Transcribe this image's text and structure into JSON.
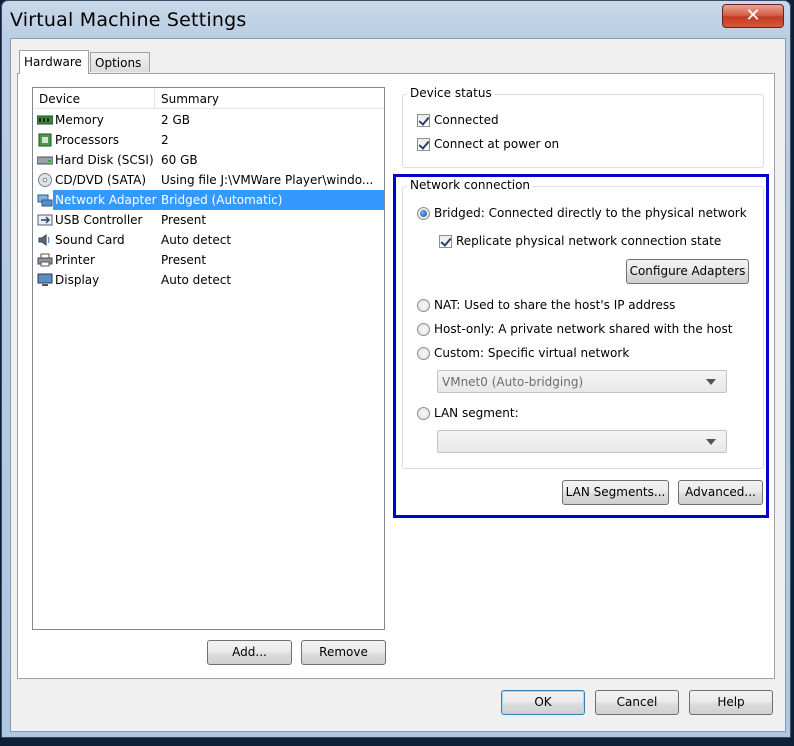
{
  "window": {
    "title": "Virtual Machine Settings",
    "close_label": "✕"
  },
  "tabs": [
    "Hardware",
    "Options"
  ],
  "device_list": {
    "headers": {
      "device": "Device",
      "summary": "Summary"
    },
    "rows": [
      {
        "name": "Memory",
        "summary": "2 GB",
        "icon": "memory-icon"
      },
      {
        "name": "Processors",
        "summary": "2",
        "icon": "processor-icon"
      },
      {
        "name": "Hard Disk (SCSI)",
        "summary": "60 GB",
        "icon": "hard-disk-icon"
      },
      {
        "name": "CD/DVD (SATA)",
        "summary": "Using file J:\\VMWare Player\\windo...",
        "icon": "cd-dvd-icon"
      },
      {
        "name": "Network Adapter",
        "summary": "Bridged (Automatic)",
        "icon": "network-adapter-icon",
        "selected": true
      },
      {
        "name": "USB Controller",
        "summary": "Present",
        "icon": "usb-icon"
      },
      {
        "name": "Sound Card",
        "summary": "Auto detect",
        "icon": "speaker-icon"
      },
      {
        "name": "Printer",
        "summary": "Present",
        "icon": "printer-icon"
      },
      {
        "name": "Display",
        "summary": "Auto detect",
        "icon": "display-icon"
      }
    ]
  },
  "list_buttons": {
    "add": "Add...",
    "remove": "Remove"
  },
  "device_status": {
    "title": "Device status",
    "connected": {
      "label": "Connected",
      "checked": true
    },
    "connect_at_power_on": {
      "label": "Connect at power on",
      "checked": true
    }
  },
  "network_connection": {
    "title": "Network connection",
    "bridged": {
      "label": "Bridged: Connected directly to the physical network",
      "checked": true
    },
    "replicate": {
      "label": "Replicate physical network connection state",
      "checked": true
    },
    "configure_adapters": "Configure Adapters",
    "nat": "NAT: Used to share the host's IP address",
    "host_only": "Host-only: A private network shared with the host",
    "custom": "Custom: Specific virtual network",
    "custom_value": "VMnet0 (Auto-bridging)",
    "lan_segment": "LAN segment:",
    "lan_segment_value": "",
    "lan_segments_button": "LAN Segments...",
    "advanced_button": "Advanced..."
  },
  "footer": {
    "ok": "OK",
    "cancel": "Cancel",
    "help": "Help"
  },
  "colors": {
    "selection": "#3399ff",
    "highlight_border": "#0000cc",
    "close_button": "#c13b22"
  }
}
